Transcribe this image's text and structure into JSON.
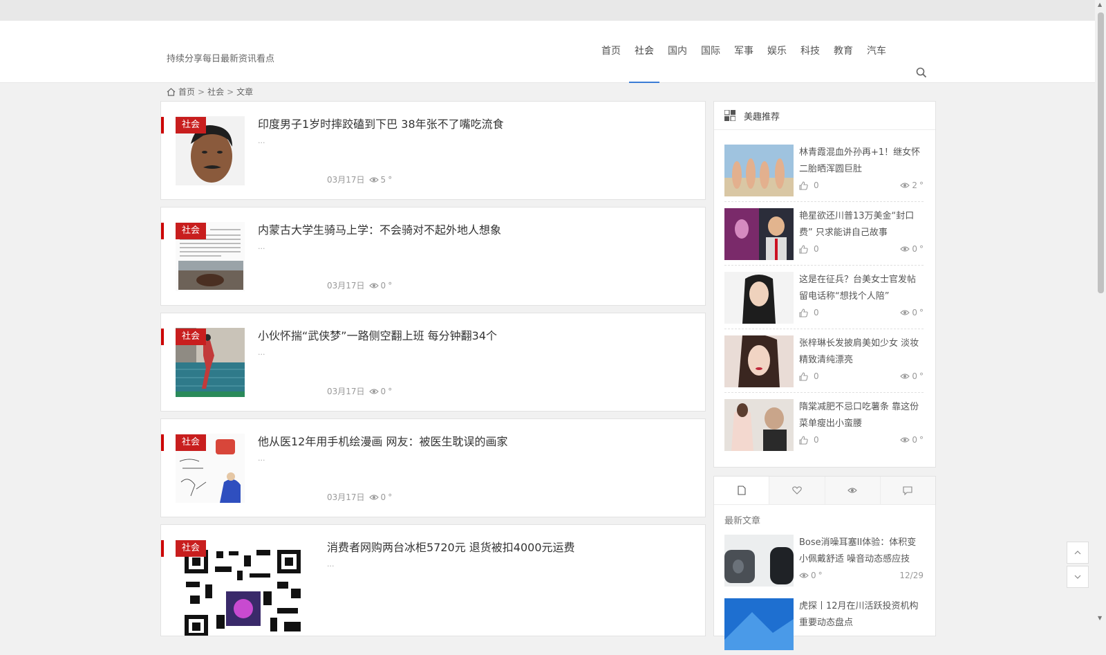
{
  "header": {
    "tagline": "持续分享每日最新资讯看点",
    "nav": [
      "首页",
      "社会",
      "国内",
      "国际",
      "军事",
      "娱乐",
      "科技",
      "教育",
      "汽车"
    ],
    "active_nav": "社会"
  },
  "breadcrumb": {
    "home": "首页",
    "category": "社会",
    "current": "文章",
    "sep": ">"
  },
  "articles": [
    {
      "category": "社会",
      "title": "印度男子1岁时摔跤磕到下巴 38年张不了嘴吃流食",
      "excerpt": "...",
      "date": "03月17日",
      "views": "5",
      "deg": "°"
    },
    {
      "category": "社会",
      "title": "内蒙古大学生骑马上学：不会骑对不起外地人想象",
      "excerpt": "...",
      "date": "03月17日",
      "views": "0",
      "deg": "°"
    },
    {
      "category": "社会",
      "title": "小伙怀揣“武侠梦”一路侧空翻上班 每分钟翻34个",
      "excerpt": "...",
      "date": "03月17日",
      "views": "0",
      "deg": "°"
    },
    {
      "category": "社会",
      "title": "他从医12年用手机绘漫画 网友：被医生耽误的画家",
      "excerpt": "...",
      "date": "03月17日",
      "views": "0",
      "deg": "°"
    },
    {
      "category": "社会",
      "title": "消费者网购两台冰柜5720元 退货被扣4000元运费",
      "excerpt": "..."
    }
  ],
  "sidebar": {
    "recommend_title": "美趣推荐",
    "recommend": [
      {
        "title": "林青霞混血外孙再+1！继女怀二胎晒浑圆巨肚",
        "likes": "0",
        "views": "2",
        "deg": "°"
      },
      {
        "title": "艳星欲还川普13万美金“封口费” 只求能讲自己故事",
        "likes": "0",
        "views": "0",
        "deg": "°"
      },
      {
        "title": "这是在征兵？台美女士官发帖留电话称“想找个人陪”",
        "likes": "0",
        "views": "0",
        "deg": "°"
      },
      {
        "title": "张梓琳长发披肩美如少女 淡妆精致清纯漂亮",
        "likes": "0",
        "views": "0",
        "deg": "°"
      },
      {
        "title": "隋棠减肥不忌口吃薯条 靠这份菜单瘦出小蛮腰",
        "likes": "0",
        "views": "0",
        "deg": "°"
      }
    ],
    "latest_label": "最新文章",
    "latest": [
      {
        "title": "Bose消噪耳塞II体验：体积变小佩戴舒适 噪音动态感应技",
        "views": "0",
        "deg": "°",
        "date": "12/29"
      },
      {
        "title": "虎探丨12月在川活跃投资机构重要动态盘点"
      }
    ]
  }
}
